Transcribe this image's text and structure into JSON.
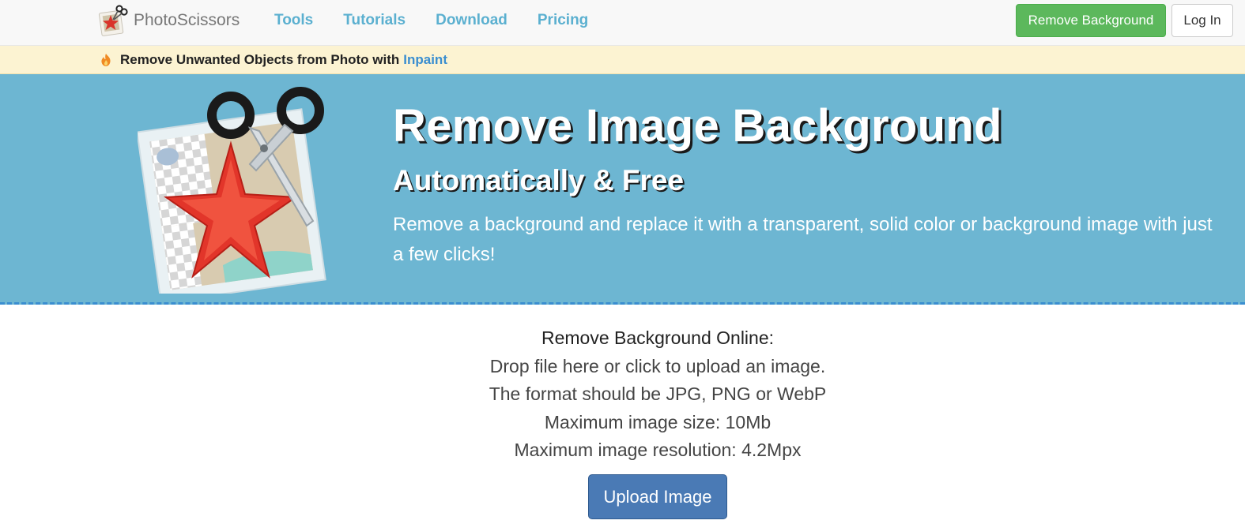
{
  "navbar": {
    "brand": "PhotoScissors",
    "links": [
      "Tools",
      "Tutorials",
      "Download",
      "Pricing"
    ],
    "remove_background_label": "Remove Background",
    "login_label": "Log In"
  },
  "promo": {
    "text": "Remove Unwanted Objects from Photo with",
    "link_label": "Inpaint"
  },
  "hero": {
    "title": "Remove Image Background",
    "subtitle": "Automatically & Free",
    "description": "Remove a background and replace it with a transparent, solid color or background image with just a few clicks!"
  },
  "upload": {
    "heading": "Remove Background Online:",
    "lines": [
      "Drop file here or click to upload an image.",
      "The format should be JPG, PNG or WebP",
      "Maximum image size: 10Mb",
      "Maximum image resolution: 4.2Mpx"
    ],
    "button_label": "Upload Image"
  },
  "colors": {
    "navbar_bg": "#f8f8f8",
    "nav_link": "#5bb0d0",
    "success_button": "#5cb85c",
    "promo_bg": "#fcf3d2",
    "promo_link": "#3a8ed0",
    "hero_bg": "#6db6d2",
    "primary_button": "#4a7ab5"
  },
  "icons": {
    "brand_logo": "photo-scissors-logo",
    "promo_icon": "flame-icon",
    "hero_art": "starfish-photo-with-scissors"
  }
}
